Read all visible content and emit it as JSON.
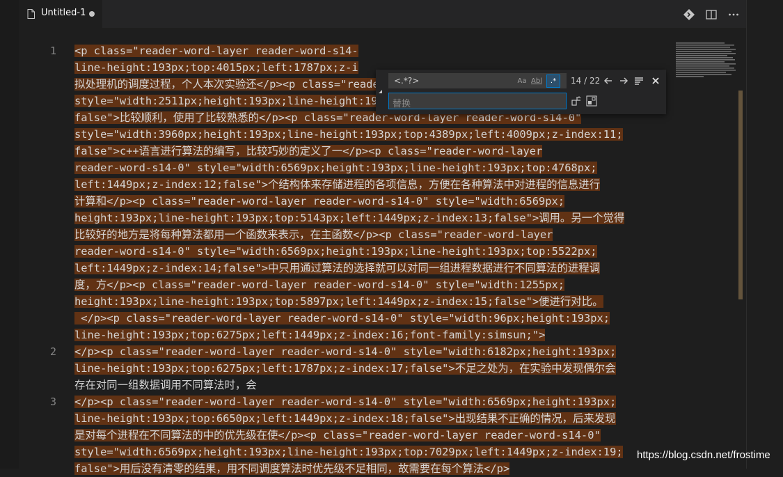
{
  "tab": {
    "title": "Untitled-1"
  },
  "icons": {
    "file": "file-icon",
    "dirty": "unsaved-dot",
    "compare": "open-changes-icon",
    "split": "split-editor-icon",
    "more": "more-actions-icon"
  },
  "line_numbers": [
    "1",
    "2",
    "3"
  ],
  "code_rows": [
    "<p class=\"reader-word-layer reader-word-s14-",
    "line-height:193px;top:4015px;left:1787px;z-i",
    "拟处理机的调度过程，个人本次实验还</p><p class=\"reader-word-layer reader-word-s14-0\"",
    "style=\"width:2511px;height:193px;line-height:193px;top:4389px;left:1449px;z-index:10;",
    "false\">比较顺利，使用了比较熟悉的</p><p class=\"reader-word-layer reader-word-s14-0\"",
    "style=\"width:3960px;height:193px;line-height:193px;top:4389px;left:4009px;z-index:11;",
    "false\">c++语言进行算法的编写，比较巧妙的定义了一</p><p class=\"reader-word-layer",
    "reader-word-s14-0\" style=\"width:6569px;height:193px;line-height:193px;top:4768px;",
    "left:1449px;z-index:12;false\">个结构体来存储进程的各项信息，方便在各种算法中对进程的信息进行",
    "计算和</p><p class=\"reader-word-layer reader-word-s14-0\" style=\"width:6569px;",
    "height:193px;line-height:193px;top:5143px;left:1449px;z-index:13;false\">调用。另一个觉得",
    "比较好的地方是将每种算法都用一个函数来表示，在主函数</p><p class=\"reader-word-layer",
    "reader-word-s14-0\" style=\"width:6569px;height:193px;line-height:193px;top:5522px;",
    "left:1449px;z-index:14;false\">中只用通过算法的选择就可以对同一组进程数据进行不同算法的进程调",
    "度，方</p><p class=\"reader-word-layer reader-word-s14-0\" style=\"width:1255px;",
    "height:193px;line-height:193px;top:5897px;left:1449px;z-index:15;false\">便进行对比。",
    " </p><p class=\"reader-word-layer reader-word-s14-0\" style=\"width:96px;height:193px;",
    "line-height:193px;top:6275px;left:1449px;z-index:16;font-family:simsun;\">",
    "</p><p class=\"reader-word-layer reader-word-s14-0\" style=\"width:6182px;height:193px;",
    "line-height:193px;top:6275px;left:1787px;z-index:17;false\">不足之处为，在实验中发现偶尔会",
    "存在对同一组数据调用不同算法时，会",
    "</p><p class=\"reader-word-layer reader-word-s14-0\" style=\"width:6569px;height:193px;",
    "line-height:193px;top:6650px;left:1449px;z-index:18;false\">出现结果不正确的情况，后来发现",
    "是对每个进程在不同算法的中的优先级在使</p><p class=\"reader-word-layer reader-word-s14-0\"",
    "style=\"width:6569px;height:193px;line-height:193px;top:7029px;left:1449px;z-index:19;",
    "false\">用后没有清零的结果，用不同调度算法时优先级不足相同，故需要在每个算法</p>"
  ],
  "find": {
    "query": "<.*?>",
    "match_case_label": "Aa",
    "whole_word_label": "Abl",
    "regex_label": ".*",
    "match_count": "14 / 22",
    "replace_placeholder": "替换"
  },
  "watermark": "https://blog.csdn.net/frostime"
}
